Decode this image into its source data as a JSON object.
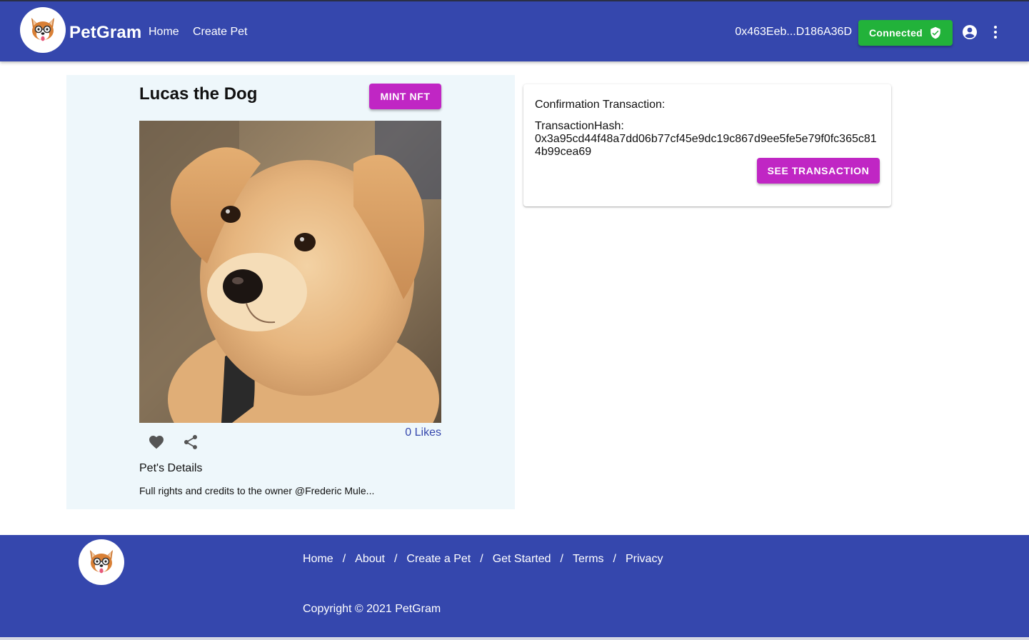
{
  "header": {
    "brand": "PetGram",
    "nav": {
      "home": "Home",
      "create_pet": "Create Pet"
    },
    "wallet_address": "0x463Eeb...D186A36D",
    "connected_label": "Connected",
    "icons": [
      "dog-logo-icon",
      "shield-check-icon",
      "account-circle-icon",
      "more-vert-icon"
    ]
  },
  "pet": {
    "name": "Lucas the Dog",
    "mint_label": "MINT NFT",
    "likes": "0 Likes",
    "details_title": "Pet's Details",
    "details_text": "Full rights and credits to the owner @Frederic Mule...",
    "icons": [
      "heart-icon",
      "share-icon"
    ]
  },
  "confirmation": {
    "title": "Confirmation Transaction:",
    "hash_label": "TransactionHash:",
    "hash_value": "0x3a95cd44f48a7dd06b77cf45e9dc19c867d9ee5fe5e79f0fc365c814b99cea69",
    "see_label": "SEE TRANSACTION"
  },
  "footer": {
    "links": {
      "home": "Home",
      "about": "About",
      "create": "Create a Pet",
      "started": "Get Started",
      "terms": "Terms",
      "privacy": "Privacy"
    },
    "separator": "/",
    "copyright": "Copyright © 2021 PetGram"
  },
  "colors": {
    "primary": "#3547ad",
    "accent": "#c026c4",
    "success": "#22b23a",
    "panel_bg": "#eef7fb"
  }
}
